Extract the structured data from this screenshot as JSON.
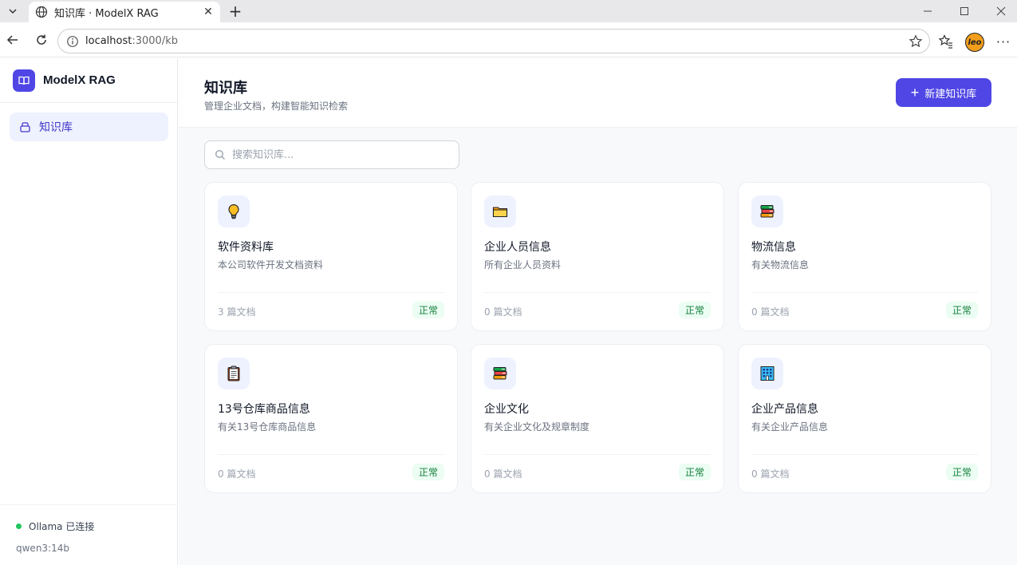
{
  "browser": {
    "tab_title": "知识库 · ModelX RAG",
    "url_host": "localhost",
    "url_path": ":3000/kb",
    "profile_initials": "leo"
  },
  "sidebar": {
    "brand": "ModelX RAG",
    "nav": [
      {
        "label": "知识库",
        "active": true
      }
    ],
    "status": "Ollama 已连接",
    "model": "qwen3:14b"
  },
  "header": {
    "title": "知识库",
    "subtitle": "管理企业文档，构建智能知识检索",
    "create_label": "新建知识库"
  },
  "search": {
    "placeholder": "搜索知识库..."
  },
  "knowledge_bases": [
    {
      "icon": "lightbulb-icon",
      "title": "软件资料库",
      "desc": "本公司软件开发文档资料",
      "count": "3 篇文档",
      "status": "正常"
    },
    {
      "icon": "folder-icon",
      "title": "企业人员信息",
      "desc": "所有企业人员资料",
      "count": "0 篇文档",
      "status": "正常"
    },
    {
      "icon": "books-icon",
      "title": "物流信息",
      "desc": "有关物流信息",
      "count": "0 篇文档",
      "status": "正常"
    },
    {
      "icon": "clipboard-icon",
      "title": "13号仓库商品信息",
      "desc": "有关13号仓库商品信息",
      "count": "0 篇文档",
      "status": "正常"
    },
    {
      "icon": "books-icon",
      "title": "企业文化",
      "desc": "有关企业文化及规章制度",
      "count": "0 篇文档",
      "status": "正常"
    },
    {
      "icon": "office-building-icon",
      "title": "企业产品信息",
      "desc": "有关企业产品信息",
      "count": "0 篇文档",
      "status": "正常"
    }
  ],
  "colors": {
    "accent": "#4f46e5",
    "status_ok": "#15803d"
  }
}
